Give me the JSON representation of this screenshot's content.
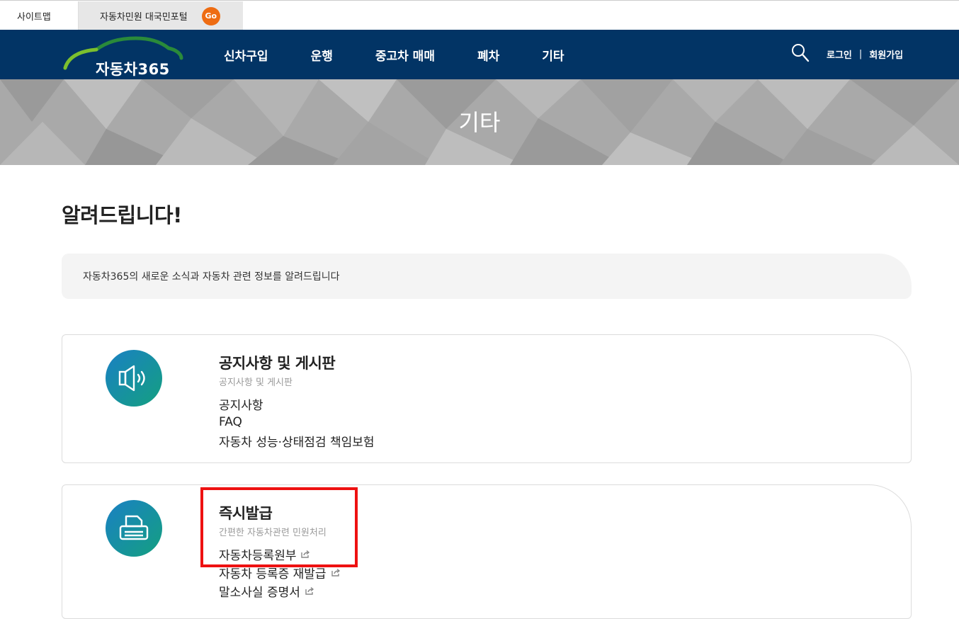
{
  "util_bar": {
    "sitemap_label": "사이트맵",
    "portal_label": "자동차민원 대국민포털",
    "go_label": "Go"
  },
  "nav": {
    "logo_text": "자동차365",
    "menu": [
      "신차구입",
      "운행",
      "중고차 매매",
      "폐차",
      "기타"
    ],
    "login_label": "로그인",
    "separator": "|",
    "signup_label": "회원가입"
  },
  "banner": {
    "title": "기타"
  },
  "page": {
    "title": "알려드립니다!",
    "intro": "자동차365의 새로운 소식과 자동차 관련 정보를 알려드립니다"
  },
  "cards": [
    {
      "title": "공지사항 및 게시판",
      "subtitle": "공지사항 및 게시판",
      "icon": "speaker-icon",
      "links": [
        "공지사항",
        "FAQ",
        "자동차 성능·상태점검 책임보험"
      ]
    },
    {
      "title": "즉시발급",
      "subtitle": "간편한 자동차관련 민원처리",
      "icon": "printer-icon",
      "links": [
        "자동차등록원부",
        "자동차 등록증 재발급",
        "말소사실 증명서"
      ]
    }
  ],
  "colors": {
    "nav_bg": "#023465",
    "go_badge": "#ee6c12",
    "icon_gradient_start": "#1a80c4",
    "icon_gradient_end": "#14a080",
    "highlight": "#ee1111"
  }
}
